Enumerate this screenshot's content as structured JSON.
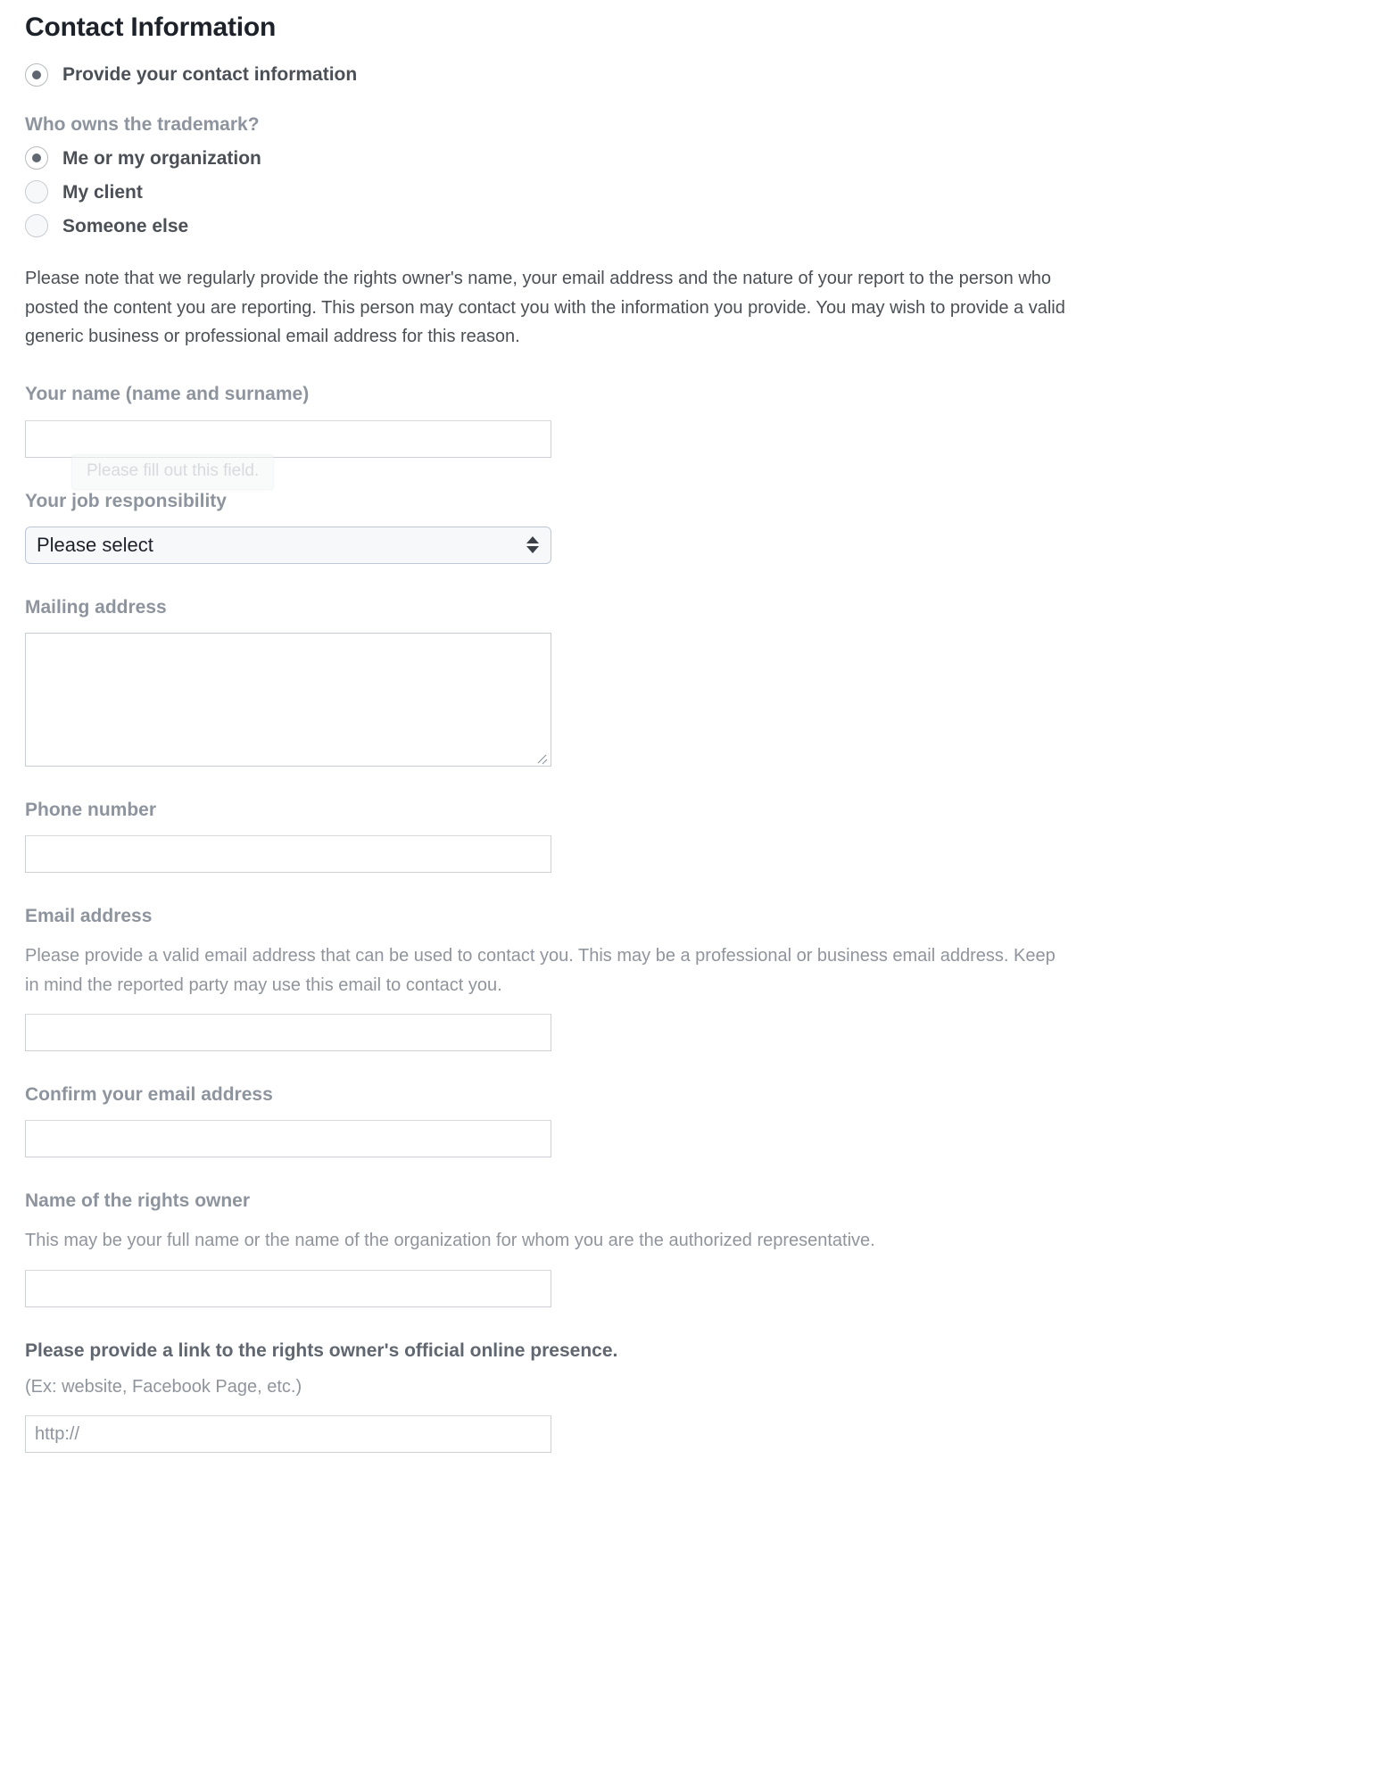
{
  "page": {
    "title": "Contact Information"
  },
  "consent": {
    "option_label": "Provide your contact information",
    "checked": true
  },
  "ownership": {
    "question": "Who owns the trademark?",
    "options": [
      {
        "label": "Me or my organization",
        "checked": true
      },
      {
        "label": "My client",
        "checked": false
      },
      {
        "label": "Someone else",
        "checked": false
      }
    ]
  },
  "notice": {
    "text": "Please note that we regularly provide the rights owner's name, your email address and the nature of your report to the person who posted the content you are reporting. This person may contact you with the information you provide. You may wish to provide a valid generic business or professional email address for this reason."
  },
  "validation": {
    "message": "Please fill out this field."
  },
  "fields": {
    "your_name": {
      "label": "Your name (name and surname)",
      "value": "",
      "placeholder": ""
    },
    "job_responsibility": {
      "label": "Your job responsibility",
      "selected": "Please select",
      "options": [
        "Please select"
      ]
    },
    "mailing_address": {
      "label": "Mailing address",
      "value": "",
      "placeholder": ""
    },
    "phone_number": {
      "label": "Phone number",
      "value": "",
      "placeholder": ""
    },
    "email_address": {
      "label": "Email address",
      "help": "Please provide a valid email address that can be used to contact you. This may be a professional or business email address. Keep in mind the reported party may use this email to contact you.",
      "value": "",
      "placeholder": ""
    },
    "confirm_email": {
      "label": "Confirm your email address",
      "value": "",
      "placeholder": ""
    },
    "rights_owner_name": {
      "label": "Name of the rights owner",
      "help": "This may be your full name or the name of the organization for whom you are the authorized representative.",
      "value": "",
      "placeholder": ""
    },
    "online_presence": {
      "label": "Please provide a link to the rights owner's official online presence.",
      "help": "(Ex: website, Facebook Page, etc.)",
      "value": "",
      "placeholder": "http://"
    }
  },
  "colors": {
    "heading": "#1d2129",
    "label": "#8d949e",
    "body": "#4b4f56",
    "help": "#90949c",
    "border": "#ccd0d5"
  }
}
